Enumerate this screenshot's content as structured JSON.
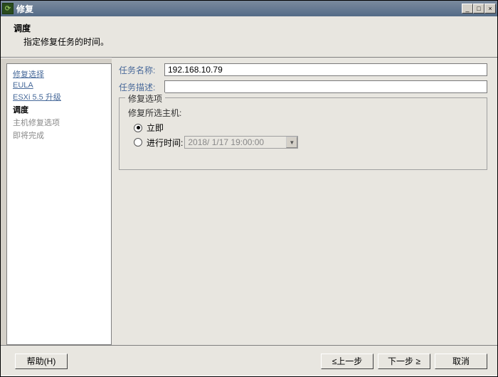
{
  "titlebar": {
    "title": "修复",
    "minimize": "_",
    "maximize": "□",
    "close": "×"
  },
  "header": {
    "title": "调度",
    "subtitle": "指定修复任务的时间。"
  },
  "sidebar": {
    "items": [
      {
        "label": "修复选择",
        "state": "done"
      },
      {
        "label": "EULA",
        "state": "done"
      },
      {
        "label": "ESXi 5.5 升级",
        "state": "done"
      },
      {
        "label": "调度",
        "state": "current"
      },
      {
        "label": "主机修复选项",
        "state": "pending"
      },
      {
        "label": "即将完成",
        "state": "pending"
      }
    ]
  },
  "form": {
    "task_name_label": "任务名称:",
    "task_name_value": "192.168.10.79",
    "task_desc_label": "任务描述:",
    "task_desc_value": ""
  },
  "options": {
    "legend": "修复选项",
    "host_label": "修复所选主机:",
    "radio_now": "立即",
    "radio_time": "进行时间:",
    "datetime_value": "2018/ 1/17 19:00:00"
  },
  "footer": {
    "help": "帮助(H)",
    "back": "≤上一步",
    "next": "下一步 ≥",
    "cancel": "取消"
  }
}
